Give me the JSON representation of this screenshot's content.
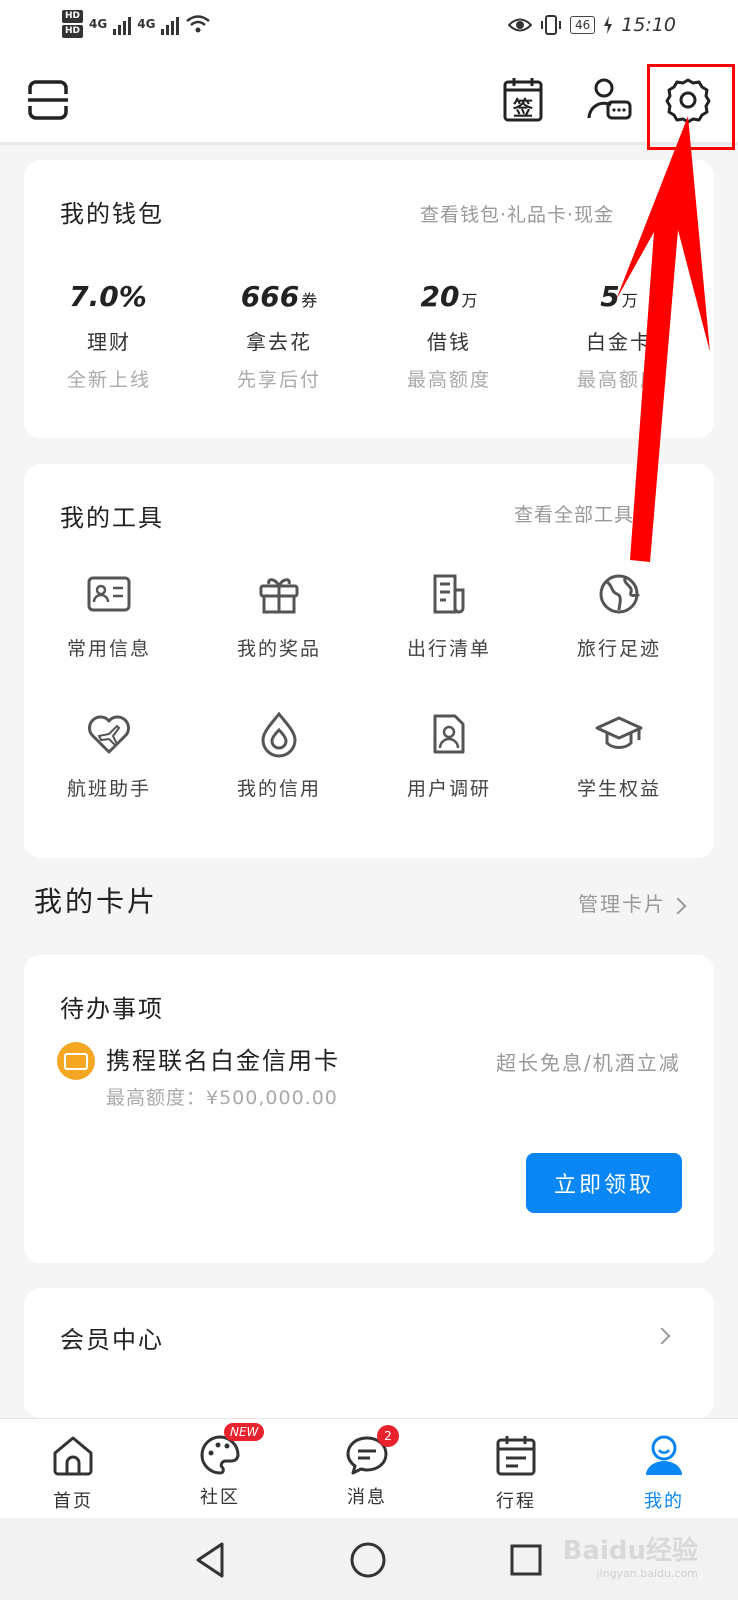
{
  "status_bar": {
    "hd1": "HD",
    "hd2": "HD",
    "net1": "4G",
    "net2": "4G",
    "battery": "46",
    "time": "15:10"
  },
  "top_bar": {
    "sign_label": "签"
  },
  "wallet": {
    "title": "我的钱包",
    "link": "查看钱包·礼品卡·现金",
    "items": [
      {
        "value": "7.0%",
        "unit": "",
        "name": "理财",
        "sub": "全新上线"
      },
      {
        "value": "666",
        "unit": "券",
        "name": "拿去花",
        "sub": "先享后付"
      },
      {
        "value": "20",
        "unit": "万",
        "name": "借钱",
        "sub": "最高额度"
      },
      {
        "value": "5",
        "unit": "万",
        "name": "白金卡",
        "sub": "最高额度"
      }
    ]
  },
  "tools": {
    "title": "我的工具",
    "link": "查看全部工具",
    "items": [
      {
        "label": "常用信息",
        "icon": "id-card-icon"
      },
      {
        "label": "我的奖品",
        "icon": "gift-icon"
      },
      {
        "label": "出行清单",
        "icon": "checklist-icon"
      },
      {
        "label": "旅行足迹",
        "icon": "globe-icon"
      },
      {
        "label": "航班助手",
        "icon": "flight-heart-icon"
      },
      {
        "label": "我的信用",
        "icon": "credit-drop-icon"
      },
      {
        "label": "用户调研",
        "icon": "survey-icon"
      },
      {
        "label": "学生权益",
        "icon": "graduation-cap-icon"
      }
    ]
  },
  "cards_section": {
    "title": "我的卡片",
    "link": "管理卡片"
  },
  "todo": {
    "title": "待办事项",
    "promo_title": "携程联名白金信用卡",
    "promo_desc": "超长免息/机酒立减",
    "promo_sub": "最高额度：¥500,000.00",
    "button": "立即领取"
  },
  "member": {
    "title": "会员中心"
  },
  "tab_bar": {
    "tabs": [
      {
        "label": "首页",
        "icon": "home-icon",
        "active": false
      },
      {
        "label": "社区",
        "icon": "community-icon",
        "active": false,
        "badge": "NEW"
      },
      {
        "label": "消息",
        "icon": "message-icon",
        "active": false,
        "badge": "2"
      },
      {
        "label": "行程",
        "icon": "calendar-icon",
        "active": false
      },
      {
        "label": "我的",
        "icon": "profile-icon",
        "active": true
      }
    ]
  },
  "watermark": {
    "main": "Baidu经验",
    "sub": "jingyan.baidu.com"
  },
  "colors": {
    "accent": "#0a86f5",
    "badge": "#e8232e",
    "promo_icon": "#f5a623",
    "annotation": "#ff0000"
  }
}
